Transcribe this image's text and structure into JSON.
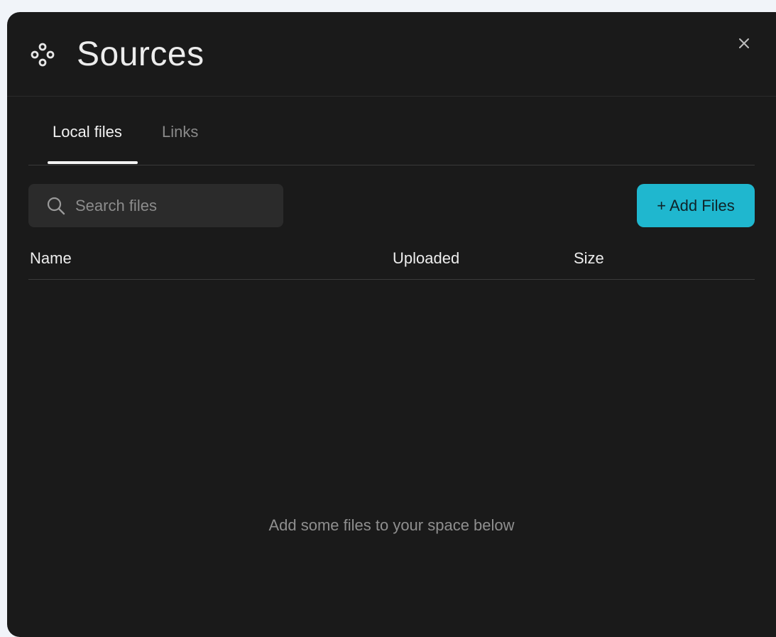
{
  "header": {
    "title": "Sources",
    "icon": "sources-dots-icon",
    "close_icon": "close-icon"
  },
  "tabs": [
    {
      "label": "Local files",
      "active": true
    },
    {
      "label": "Links",
      "active": false
    }
  ],
  "search": {
    "placeholder": "Search files",
    "value": ""
  },
  "actions": {
    "add_files_label": "+ Add Files"
  },
  "table": {
    "columns": [
      "Name",
      "Uploaded",
      "Size"
    ],
    "rows": []
  },
  "empty_state": "Add some files to your space below",
  "colors": {
    "background": "#f1f4f9",
    "panel": "#1a1a1a",
    "accent": "#1fb7cf",
    "input": "#2b2b2b"
  }
}
